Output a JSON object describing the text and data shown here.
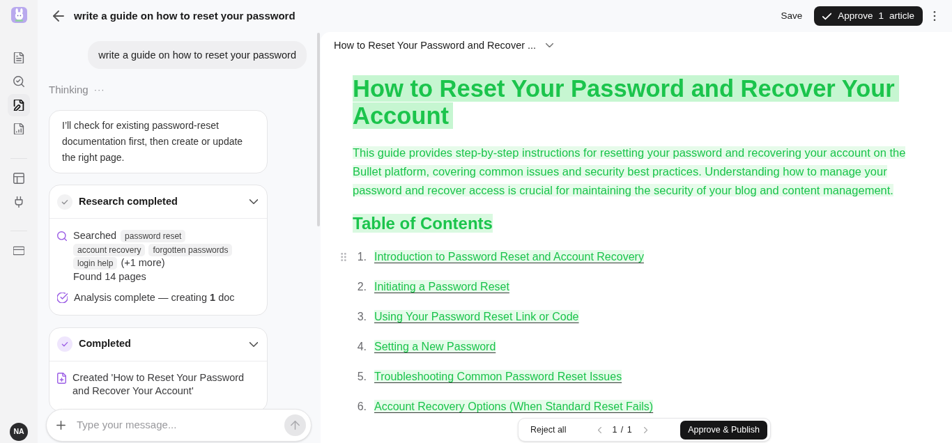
{
  "sidebar": {
    "groups": [
      {
        "items": [
          {
            "selected": false
          },
          {
            "selected": false
          },
          {
            "selected": true
          },
          {
            "selected": false
          }
        ]
      },
      {
        "items": [
          {
            "selected": false
          },
          {
            "selected": false
          }
        ]
      },
      {
        "items": [
          {
            "selected": false
          }
        ]
      }
    ],
    "avatar": "NA"
  },
  "header": {
    "title": "write a guide on how to reset your password",
    "save": "Save",
    "approve": {
      "label": "Approve",
      "count": "1",
      "unit": "article"
    }
  },
  "chat": {
    "messages": [
      {
        "kind": "user",
        "text": "write a guide on how to reset your password"
      },
      {
        "kind": "status",
        "text": "Thinking",
        "dots": "···"
      },
      {
        "kind": "assistant",
        "text": "I’ll check for existing password-reset documentation first, then create or update the right page."
      },
      {
        "kind": "steps",
        "title": "Research completed",
        "accent": false,
        "expanded": true,
        "rows": [
          {
            "kind": "search",
            "label": "Searched",
            "tags": [
              "password reset",
              "account recovery",
              "forgotten passwords",
              "login help"
            ],
            "more": "(+1 more)",
            "result": "Found 14 pages"
          },
          {
            "kind": "check",
            "text": "Analysis complete — creating **1** doc"
          }
        ]
      },
      {
        "kind": "steps",
        "title": "Completed",
        "accent": true,
        "expanded": true,
        "rows": [
          {
            "kind": "file",
            "text": "Created 'How to Reset Your Password and Recover Your Account'"
          }
        ]
      }
    ],
    "input": {
      "placeholder": "Type your message..."
    }
  },
  "document": {
    "selector": "How to Reset Your Password and Recover ...",
    "blocks": [
      {
        "kind": "title",
        "added": true,
        "text": "How to Reset Your Password and Recover Your Account"
      },
      {
        "kind": "paragraph",
        "added": true,
        "text": "This guide provides step-by-step instructions for resetting your password and recovering your account on the Bullet platform, covering common issues and security best practices. Understanding how to manage your password and recover access is crucial for maintaining the security of your blog and content management."
      },
      {
        "kind": "heading",
        "added": true,
        "text": "Table of Contents"
      },
      {
        "kind": "list",
        "added": true,
        "items": [
          {
            "number": "1.",
            "text": "Introduction to Password Reset and Account Recovery",
            "hovered": true
          },
          {
            "number": "2.",
            "text": "Initiating a Password Reset",
            "hovered": false
          },
          {
            "number": "3.",
            "text": "Using Your Password Reset Link or Code",
            "hovered": false
          },
          {
            "number": "4.",
            "text": "Setting a New Password",
            "hovered": false
          },
          {
            "number": "5.",
            "text": "Troubleshooting Common Password Reset Issues",
            "hovered": false
          },
          {
            "number": "6.",
            "text": "Account Recovery Options (When Standard Reset Fails)",
            "hovered": false
          }
        ]
      }
    ],
    "review_bar": {
      "reject": "Reject all",
      "page": "1 / 1",
      "publish": "Approve & Publish"
    }
  }
}
